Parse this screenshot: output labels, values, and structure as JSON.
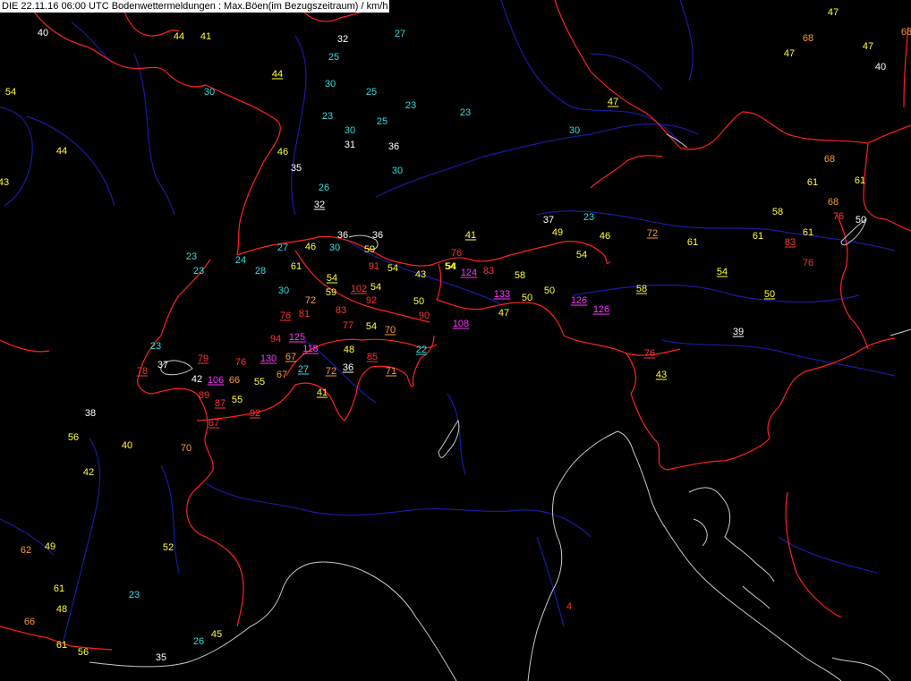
{
  "title": "DIE 22.11.16 06:00 UTC  Bodenwettermeldungen :  Max.Böen(im Bezugszeitraum) / km/h",
  "colors": {
    "background": "#000000",
    "border": "#ff2020",
    "river": "#1a1aa0",
    "coast": "#c8c8c8",
    "white": "#ffffff",
    "cyan": "#33dddd",
    "yellow": "#ffff33",
    "orange": "#ff9933",
    "red": "#ff3333",
    "magenta": "#ff33ff"
  },
  "observations": [
    {
      "v": "40",
      "c": "white"
    },
    {
      "v": "44",
      "c": "yellow"
    },
    {
      "v": "41",
      "c": "yellow"
    },
    {
      "v": "32",
      "c": "white"
    },
    {
      "v": "27",
      "c": "cyan"
    },
    {
      "v": "47",
      "c": "yellow"
    },
    {
      "v": "68",
      "c": "orange"
    },
    {
      "v": "47",
      "c": "yellow"
    },
    {
      "v": "47",
      "c": "yellow"
    },
    {
      "v": "40",
      "c": "white"
    },
    {
      "v": "68",
      "c": "orange"
    },
    {
      "v": "54",
      "c": "yellow"
    },
    {
      "v": "30",
      "c": "cyan"
    },
    {
      "v": "44",
      "c": "yellow",
      "u": true
    },
    {
      "v": "25",
      "c": "cyan"
    },
    {
      "v": "30",
      "c": "cyan"
    },
    {
      "v": "25",
      "c": "cyan"
    },
    {
      "v": "23",
      "c": "cyan"
    },
    {
      "v": "23",
      "c": "cyan"
    },
    {
      "v": "25",
      "c": "cyan"
    },
    {
      "v": "23",
      "c": "cyan"
    },
    {
      "v": "47",
      "c": "yellow",
      "u": true
    },
    {
      "v": "30",
      "c": "cyan"
    },
    {
      "v": "30",
      "c": "cyan"
    },
    {
      "v": "31",
      "c": "white"
    },
    {
      "v": "36",
      "c": "white"
    },
    {
      "v": "44",
      "c": "yellow"
    },
    {
      "v": "46",
      "c": "yellow"
    },
    {
      "v": "35",
      "c": "white"
    },
    {
      "v": "30",
      "c": "cyan"
    },
    {
      "v": "43",
      "c": "yellow"
    },
    {
      "v": "26",
      "c": "cyan"
    },
    {
      "v": "32",
      "c": "white",
      "u": true
    },
    {
      "v": "68",
      "c": "orange"
    },
    {
      "v": "61",
      "c": "yellow"
    },
    {
      "v": "61",
      "c": "yellow"
    },
    {
      "v": "68",
      "c": "orange"
    },
    {
      "v": "58",
      "c": "yellow"
    },
    {
      "v": "76",
      "c": "red"
    },
    {
      "v": "50",
      "c": "white"
    },
    {
      "v": "36",
      "c": "white"
    },
    {
      "v": "36",
      "c": "white"
    },
    {
      "v": "37",
      "c": "white"
    },
    {
      "v": "23",
      "c": "cyan"
    },
    {
      "v": "27",
      "c": "cyan"
    },
    {
      "v": "46",
      "c": "yellow"
    },
    {
      "v": "30",
      "c": "cyan"
    },
    {
      "v": "59",
      "c": "yellow"
    },
    {
      "v": "41",
      "c": "yellow",
      "u": true
    },
    {
      "v": "49",
      "c": "yellow"
    },
    {
      "v": "46",
      "c": "yellow"
    },
    {
      "v": "72",
      "c": "orange",
      "u": true
    },
    {
      "v": "61",
      "c": "yellow"
    },
    {
      "v": "61",
      "c": "yellow"
    },
    {
      "v": "61",
      "c": "yellow"
    },
    {
      "v": "83",
      "c": "red",
      "u": true
    },
    {
      "v": "23",
      "c": "cyan"
    },
    {
      "v": "24",
      "c": "cyan"
    },
    {
      "v": "76",
      "c": "red"
    },
    {
      "v": "54",
      "c": "yellow"
    },
    {
      "v": "91",
      "c": "red"
    },
    {
      "v": "54",
      "c": "yellow"
    },
    {
      "v": "76",
      "c": "red"
    },
    {
      "v": "23",
      "c": "cyan"
    },
    {
      "v": "28",
      "c": "cyan"
    },
    {
      "v": "61",
      "c": "yellow"
    },
    {
      "v": "54",
      "c": "yellow",
      "u": true
    },
    {
      "v": "43",
      "c": "yellow"
    },
    {
      "v": "54",
      "c": "yellow"
    },
    {
      "v": "124",
      "c": "magenta",
      "u": true
    },
    {
      "v": "83",
      "c": "red"
    },
    {
      "v": "58",
      "c": "yellow"
    },
    {
      "v": "54",
      "c": "yellow"
    },
    {
      "v": "54",
      "c": "yellow",
      "u": true
    },
    {
      "v": "30",
      "c": "cyan"
    },
    {
      "v": "59",
      "c": "yellow"
    },
    {
      "v": "102",
      "c": "red",
      "u": true
    },
    {
      "v": "54",
      "c": "yellow"
    },
    {
      "v": "72",
      "c": "orange"
    },
    {
      "v": "92",
      "c": "red"
    },
    {
      "v": "50",
      "c": "yellow"
    },
    {
      "v": "133",
      "c": "magenta",
      "u": true
    },
    {
      "v": "50",
      "c": "yellow"
    },
    {
      "v": "50",
      "c": "yellow"
    },
    {
      "v": "58",
      "c": "yellow",
      "u": true
    },
    {
      "v": "50",
      "c": "yellow",
      "u": true
    },
    {
      "v": "81",
      "c": "red"
    },
    {
      "v": "83",
      "c": "red"
    },
    {
      "v": "126",
      "c": "magenta",
      "u": true
    },
    {
      "v": "126",
      "c": "magenta",
      "u": true
    },
    {
      "v": "76",
      "c": "red",
      "u": true
    },
    {
      "v": "90",
      "c": "red"
    },
    {
      "v": "47",
      "c": "yellow"
    },
    {
      "v": "77",
      "c": "red"
    },
    {
      "v": "108",
      "c": "magenta",
      "u": true
    },
    {
      "v": "23",
      "c": "cyan"
    },
    {
      "v": "94",
      "c": "red"
    },
    {
      "v": "125",
      "c": "magenta",
      "u": true
    },
    {
      "v": "54",
      "c": "yellow"
    },
    {
      "v": "70",
      "c": "orange",
      "u": true
    },
    {
      "v": "39",
      "c": "white",
      "u": true
    },
    {
      "v": "118",
      "c": "magenta",
      "u": true
    },
    {
      "v": "48",
      "c": "yellow"
    },
    {
      "v": "79",
      "c": "red",
      "u": true
    },
    {
      "v": "37",
      "c": "white"
    },
    {
      "v": "130",
      "c": "magenta",
      "u": true
    },
    {
      "v": "67",
      "c": "orange",
      "u": true
    },
    {
      "v": "85",
      "c": "red",
      "u": true
    },
    {
      "v": "22",
      "c": "cyan",
      "u": true
    },
    {
      "v": "76",
      "c": "red",
      "u": true
    },
    {
      "v": "78",
      "c": "red",
      "u": true
    },
    {
      "v": "76",
      "c": "red"
    },
    {
      "v": "27",
      "c": "cyan",
      "u": true
    },
    {
      "v": "36",
      "c": "white",
      "u": true
    },
    {
      "v": "72",
      "c": "orange",
      "u": true
    },
    {
      "v": "71",
      "c": "orange",
      "u": true
    },
    {
      "v": "43",
      "c": "yellow",
      "u": true
    },
    {
      "v": "42",
      "c": "white"
    },
    {
      "v": "106",
      "c": "magenta",
      "u": true
    },
    {
      "v": "66",
      "c": "orange"
    },
    {
      "v": "55",
      "c": "yellow"
    },
    {
      "v": "67",
      "c": "orange"
    },
    {
      "v": "41",
      "c": "yellow",
      "u": true
    },
    {
      "v": "89",
      "c": "red"
    },
    {
      "v": "87",
      "c": "red",
      "u": true
    },
    {
      "v": "55",
      "c": "yellow"
    },
    {
      "v": "38",
      "c": "white"
    },
    {
      "v": "92",
      "c": "red",
      "u": true
    },
    {
      "v": "67",
      "c": "red",
      "u": true
    },
    {
      "v": "56",
      "c": "yellow"
    },
    {
      "v": "40",
      "c": "yellow"
    },
    {
      "v": "70",
      "c": "orange"
    },
    {
      "v": "42",
      "c": "yellow"
    },
    {
      "v": "62",
      "c": "orange"
    },
    {
      "v": "49",
      "c": "yellow"
    },
    {
      "v": "52",
      "c": "yellow"
    },
    {
      "v": "61",
      "c": "yellow"
    },
    {
      "v": "23",
      "c": "cyan"
    },
    {
      "v": "48",
      "c": "yellow"
    },
    {
      "v": "66",
      "c": "orange"
    },
    {
      "v": "4",
      "c": "red"
    },
    {
      "v": "61",
      "c": "yellow"
    },
    {
      "v": "56",
      "c": "yellow"
    },
    {
      "v": "45",
      "c": "yellow"
    },
    {
      "v": "26",
      "c": "cyan"
    },
    {
      "v": "35",
      "c": "white"
    }
  ]
}
